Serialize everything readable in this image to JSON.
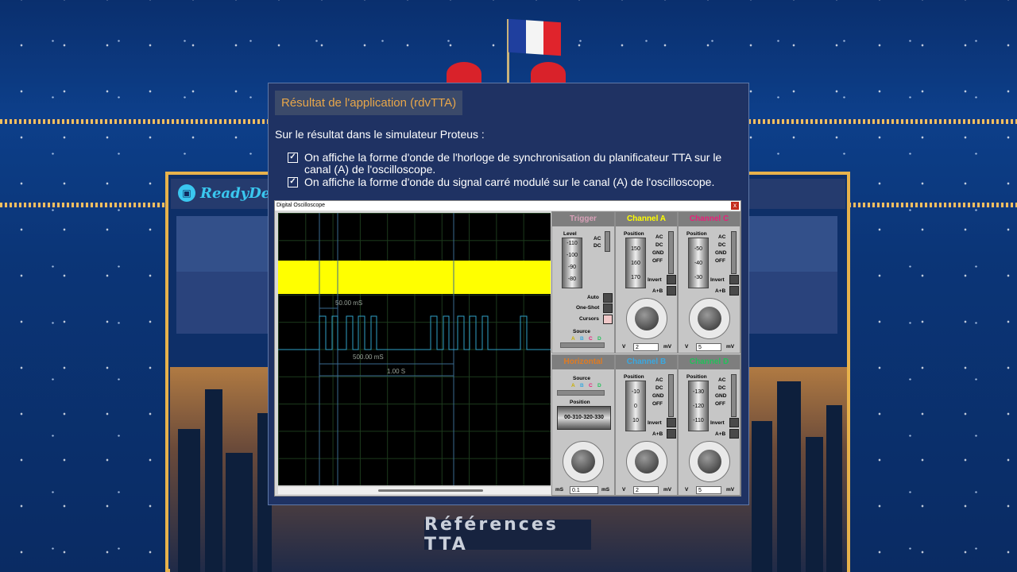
{
  "site": {
    "logo_text": "ReadyDev",
    "footer_title": "Références TTA"
  },
  "colors": {
    "accent_orange": "#e7a64a",
    "modal_bg": "#1f3263",
    "trace_yellow": "#ffff00",
    "trace_cyan": "#2f9fc6"
  },
  "modal": {
    "title": "Résultat de l'application (rdvTTA)",
    "intro": "Sur le résultat dans le simulateur Proteus :",
    "bullets": [
      "On affiche la forme d'onde de l'horloge de synchronisation du planificateur TTA sur le canal (A) de l'oscilloscope.",
      "On affiche la forme d'onde du signal carré modulé sur le canal (A) de l'oscilloscope."
    ],
    "check_icon": "checkbox-checked-icon"
  },
  "oscilloscope": {
    "window_title": "Digital Oscilloscope",
    "close_glyph": "x",
    "measure_labels": [
      "50.00 mS",
      "500.00 mS",
      "1.00 S"
    ],
    "trigger": {
      "title": "Trigger",
      "level_label": "Level",
      "level_ticks": [
        "-110",
        "-100",
        "-90",
        "-80"
      ],
      "coupling": [
        "AC",
        "DC"
      ],
      "modes": [
        "Auto",
        "One-Shot",
        "Cursors"
      ],
      "source_label": "Source",
      "source_channels": [
        "A",
        "B",
        "C",
        "D"
      ]
    },
    "horizontal": {
      "title": "Horizontal",
      "source_label": "Source",
      "source_channels": [
        "A",
        "B",
        "C",
        "D"
      ],
      "position_label": "Position",
      "position_readout": "00-310-320-330",
      "unit_left": "mS",
      "value": "0.1",
      "unit_right": "mS"
    },
    "channels": [
      {
        "name": "Channel A",
        "color": "#ffff00",
        "position_label": "Position",
        "ticks": [
          "150",
          "160",
          "170"
        ],
        "coupling": [
          "AC",
          "DC",
          "GND",
          "OFF"
        ],
        "invert": "Invert",
        "sum": "A+B",
        "unit_left": "V",
        "value": "2",
        "unit_right": "mV"
      },
      {
        "name": "Channel C",
        "color": "#e8207a",
        "position_label": "Position",
        "ticks": [
          "-50",
          "-40",
          "-30"
        ],
        "coupling": [
          "AC",
          "DC",
          "GND",
          "OFF"
        ],
        "invert": "Invert",
        "sum": "A+B",
        "unit_left": "V",
        "value": "5",
        "unit_right": "mV"
      },
      {
        "name": "Channel B",
        "color": "#3aa8e0",
        "position_label": "Position",
        "ticks": [
          "-10",
          "0",
          "10"
        ],
        "coupling": [
          "AC",
          "DC",
          "GND",
          "OFF"
        ],
        "invert": "Invert",
        "sum": "A+B",
        "unit_left": "V",
        "value": "2",
        "unit_right": "mV"
      },
      {
        "name": "Channel D",
        "color": "#22c05a",
        "position_label": "Position",
        "ticks": [
          "-130",
          "-120",
          "-110"
        ],
        "coupling": [
          "AC",
          "DC",
          "GND",
          "OFF"
        ],
        "invert": "Invert",
        "sum": "A+B",
        "unit_left": "V",
        "value": "5",
        "unit_right": "mV"
      }
    ]
  }
}
